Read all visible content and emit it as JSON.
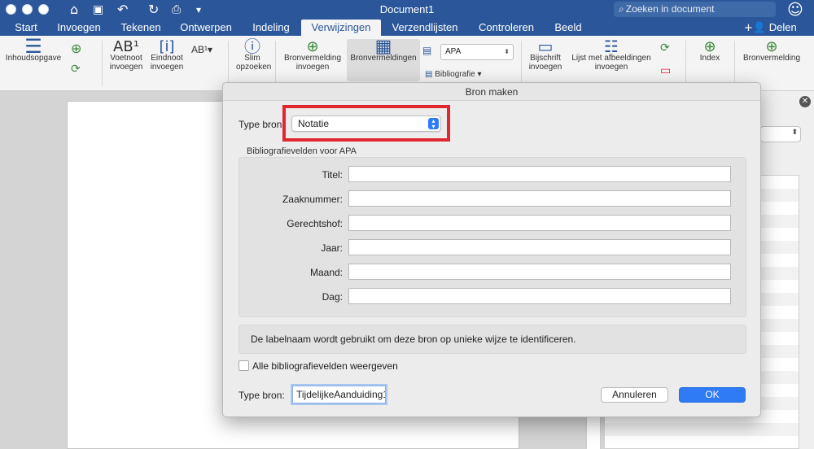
{
  "app": {
    "document_title": "Document1",
    "search_placeholder": "Zoeken in document",
    "share_label": "Delen"
  },
  "tabs": [
    {
      "label": "Start"
    },
    {
      "label": "Invoegen"
    },
    {
      "label": "Tekenen"
    },
    {
      "label": "Ontwerpen"
    },
    {
      "label": "Indeling"
    },
    {
      "label": "Verwijzingen",
      "active": true
    },
    {
      "label": "Verzendlijsten"
    },
    {
      "label": "Controleren"
    },
    {
      "label": "Beeld"
    }
  ],
  "ribbon": {
    "toc": "Inhoudsopgave",
    "footnote_1": "Voetnoot",
    "footnote_2": "invoegen",
    "endnote_1": "Eindnoot",
    "endnote_2": "invoegen",
    "smart_lookup_1": "Slim",
    "smart_lookup_2": "opzoeken",
    "citation_1": "Bronvermelding",
    "citation_2": "invoegen",
    "citations": "Bronvermeldingen",
    "style_value": "APA",
    "bibliography": "Bibliografie",
    "caption_1": "Bijschrift",
    "caption_2": "invoegen",
    "table_of_figures_1": "Lijst met afbeeldingen",
    "table_of_figures_2": "invoegen",
    "index": "Index",
    "citation_right": "Bronvermelding"
  },
  "dialog": {
    "title": "Bron maken",
    "type_label": "Type bron",
    "type_value": "Notatie",
    "group_caption": "Bibliografievelden voor APA",
    "fields": [
      {
        "label": "Titel:",
        "value": ""
      },
      {
        "label": "Zaaknummer:",
        "value": ""
      },
      {
        "label": "Gerechtshof:",
        "value": ""
      },
      {
        "label": "Jaar:",
        "value": ""
      },
      {
        "label": "Maand:",
        "value": ""
      },
      {
        "label": "Dag:",
        "value": ""
      }
    ],
    "info_text": "De labelnaam wordt gebruikt om deze bron op unieke wijze te identificeren.",
    "show_all_label": "Alle bibliografievelden weergeven",
    "tag_label": "Type bron:",
    "tag_value": "TijdelijkeAanduiding1",
    "cancel_label": "Annuleren",
    "ok_label": "OK"
  },
  "colors": {
    "brand": "#2b579a",
    "accent": "#2f7bf6",
    "highlight": "#e0262e"
  }
}
